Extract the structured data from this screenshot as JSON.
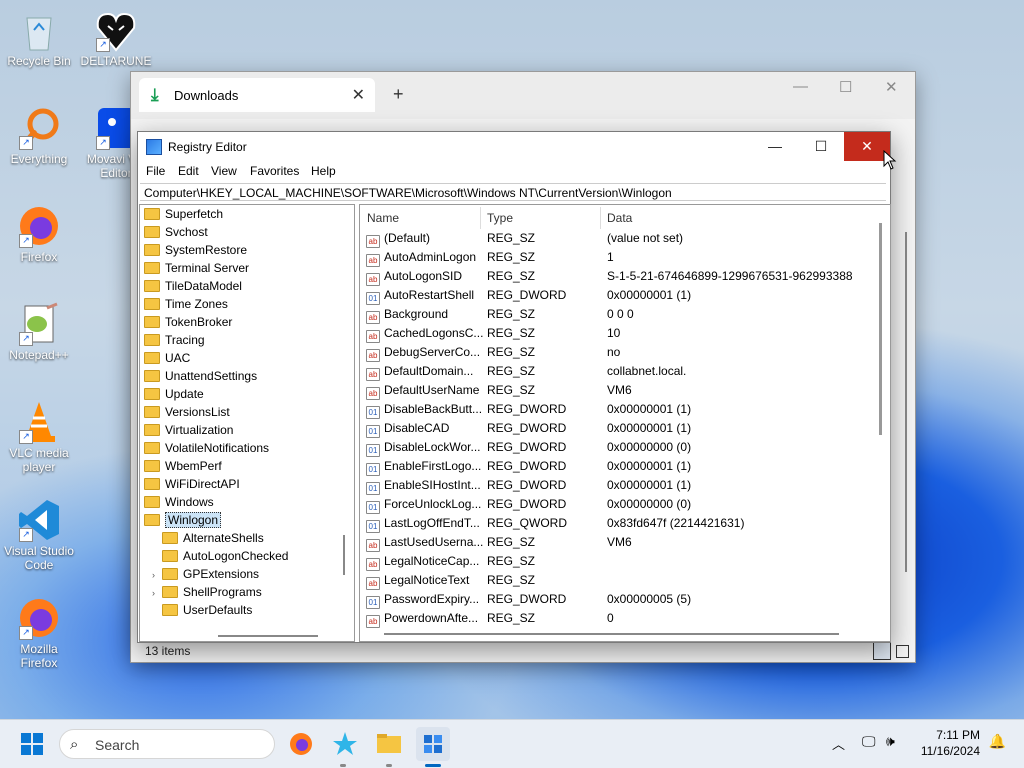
{
  "desktop": {
    "icons": [
      {
        "label": "Recycle Bin"
      },
      {
        "label": "DELTARUNE"
      },
      {
        "label": "Everything"
      },
      {
        "label": "Movavi V... Editor"
      },
      {
        "label": "Firefox"
      },
      {
        "label": "Notepad++"
      },
      {
        "label": "VLC media player"
      },
      {
        "label": "Visual Studio Code"
      },
      {
        "label": "Mozilla Firefox"
      }
    ]
  },
  "explorer": {
    "tab_label": "Downloads",
    "close_tab": "✕",
    "new_tab": "+",
    "status": "13 items"
  },
  "regedit": {
    "title": "Registry Editor",
    "menu": [
      "File",
      "Edit",
      "View",
      "Favorites",
      "Help"
    ],
    "address": "Computer\\HKEY_LOCAL_MACHINE\\SOFTWARE\\Microsoft\\Windows NT\\CurrentVersion\\Winlogon",
    "tree": [
      {
        "label": "Superfetch"
      },
      {
        "label": "Svchost"
      },
      {
        "label": "SystemRestore"
      },
      {
        "label": "Terminal Server"
      },
      {
        "label": "TileDataModel"
      },
      {
        "label": "Time Zones"
      },
      {
        "label": "TokenBroker"
      },
      {
        "label": "Tracing"
      },
      {
        "label": "UAC"
      },
      {
        "label": "UnattendSettings"
      },
      {
        "label": "Update"
      },
      {
        "label": "VersionsList"
      },
      {
        "label": "Virtualization"
      },
      {
        "label": "VolatileNotifications"
      },
      {
        "label": "WbemPerf"
      },
      {
        "label": "WiFiDirectAPI"
      },
      {
        "label": "Windows"
      },
      {
        "label": "Winlogon"
      },
      {
        "label": "AlternateShells"
      },
      {
        "label": "AutoLogonChecked"
      },
      {
        "label": "GPExtensions"
      },
      {
        "label": "ShellPrograms"
      },
      {
        "label": "UserDefaults"
      }
    ],
    "columns": [
      "Name",
      "Type",
      "Data"
    ],
    "values": [
      {
        "name": "(Default)",
        "type": "REG_SZ",
        "data": "(value not set)"
      },
      {
        "name": "AutoAdminLogon",
        "type": "REG_SZ",
        "data": "1"
      },
      {
        "name": "AutoLogonSID",
        "type": "REG_SZ",
        "data": "S-1-5-21-674646899-1299676531-962993388"
      },
      {
        "name": "AutoRestartShell",
        "type": "REG_DWORD",
        "data": "0x00000001 (1)"
      },
      {
        "name": "Background",
        "type": "REG_SZ",
        "data": "0 0 0"
      },
      {
        "name": "CachedLogonsC...",
        "type": "REG_SZ",
        "data": "10"
      },
      {
        "name": "DebugServerCo...",
        "type": "REG_SZ",
        "data": "no"
      },
      {
        "name": "DefaultDomain...",
        "type": "REG_SZ",
        "data": "collabnet.local."
      },
      {
        "name": "DefaultUserName",
        "type": "REG_SZ",
        "data": "VM6"
      },
      {
        "name": "DisableBackButt...",
        "type": "REG_DWORD",
        "data": "0x00000001 (1)"
      },
      {
        "name": "DisableCAD",
        "type": "REG_DWORD",
        "data": "0x00000001 (1)"
      },
      {
        "name": "DisableLockWor...",
        "type": "REG_DWORD",
        "data": "0x00000000 (0)"
      },
      {
        "name": "EnableFirstLogo...",
        "type": "REG_DWORD",
        "data": "0x00000001 (1)"
      },
      {
        "name": "EnableSIHostInt...",
        "type": "REG_DWORD",
        "data": "0x00000001 (1)"
      },
      {
        "name": "ForceUnlockLog...",
        "type": "REG_DWORD",
        "data": "0x00000000 (0)"
      },
      {
        "name": "LastLogOffEndT...",
        "type": "REG_QWORD",
        "data": "0x83fd647f (2214421631)"
      },
      {
        "name": "LastUsedUserna...",
        "type": "REG_SZ",
        "data": "VM6"
      },
      {
        "name": "LegalNoticeCap...",
        "type": "REG_SZ",
        "data": ""
      },
      {
        "name": "LegalNoticeText",
        "type": "REG_SZ",
        "data": ""
      },
      {
        "name": "PasswordExpiry...",
        "type": "REG_DWORD",
        "data": "0x00000005 (5)"
      },
      {
        "name": "PowerdownAfte...",
        "type": "REG_SZ",
        "data": "0"
      }
    ]
  },
  "taskbar": {
    "search_placeholder": "Search",
    "time": "7:11 PM",
    "date": "11/16/2024"
  },
  "colors": {
    "close_red": "#c42b1c",
    "accent": "#0067c0"
  }
}
